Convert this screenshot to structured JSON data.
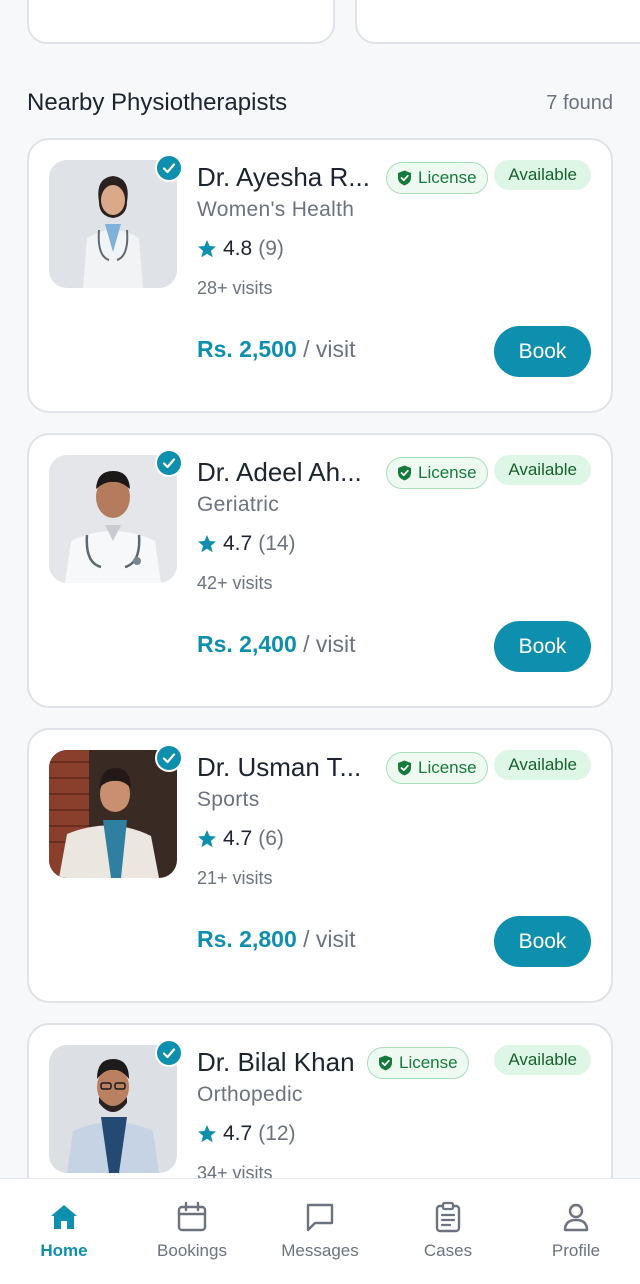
{
  "section": {
    "title": "Nearby Physiotherapists",
    "count": "7 found"
  },
  "colors": {
    "accent": "#0e8fae",
    "license_text": "#167a3c",
    "available_bg": "#def6e5"
  },
  "doctors": [
    {
      "name": "Dr. Ayesha R...",
      "license": "License",
      "availability": "Available",
      "specialty": "Women's Health",
      "rating": "4.8",
      "reviews": "(9)",
      "visits": "28+ visits",
      "price": "Rs. 2,500",
      "price_unit": "/ visit",
      "book": "Book",
      "verified_icon": "check-badge-icon"
    },
    {
      "name": "Dr. Adeel Ah...",
      "license": "License",
      "availability": "Available",
      "specialty": "Geriatric",
      "rating": "4.7",
      "reviews": "(14)",
      "visits": "42+ visits",
      "price": "Rs. 2,400",
      "price_unit": "/ visit",
      "book": "Book",
      "verified_icon": "check-badge-icon"
    },
    {
      "name": "Dr. Usman T...",
      "license": "License",
      "availability": "Available",
      "specialty": "Sports",
      "rating": "4.7",
      "reviews": "(6)",
      "visits": "21+ visits",
      "price": "Rs. 2,800",
      "price_unit": "/ visit",
      "book": "Book",
      "verified_icon": "check-badge-icon"
    },
    {
      "name": "Dr. Bilal Khan",
      "license": "License",
      "availability": "Available",
      "specialty": "Orthopedic",
      "rating": "4.7",
      "reviews": "(12)",
      "visits": "34+ visits",
      "verified_icon": "check-badge-icon"
    }
  ],
  "nav": [
    {
      "label": "Home",
      "icon": "home-icon",
      "active": true
    },
    {
      "label": "Bookings",
      "icon": "calendar-icon",
      "active": false
    },
    {
      "label": "Messages",
      "icon": "chat-icon",
      "active": false
    },
    {
      "label": "Cases",
      "icon": "clipboard-icon",
      "active": false
    },
    {
      "label": "Profile",
      "icon": "user-icon",
      "active": false
    }
  ]
}
